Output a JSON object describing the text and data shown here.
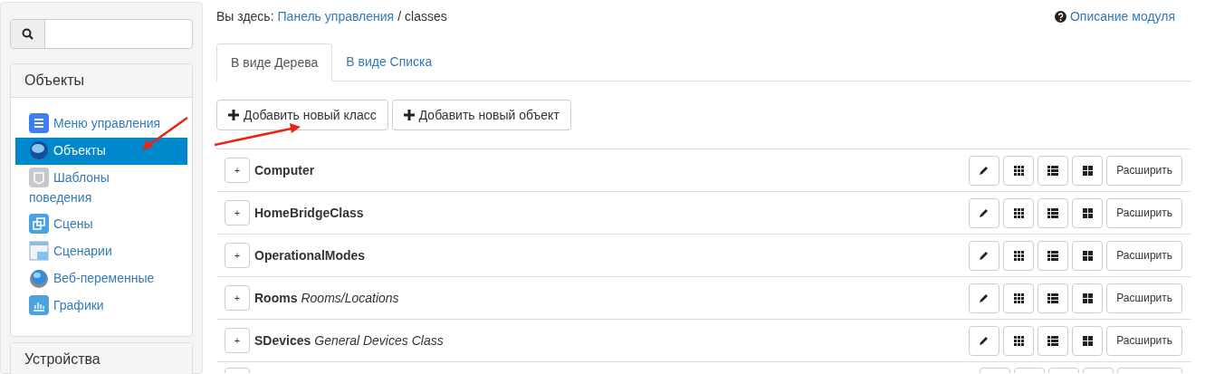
{
  "sidebar": {
    "panels": [
      {
        "title": "Объекты",
        "expanded": true,
        "items": [
          {
            "label": "Меню управления",
            "kind": "menu",
            "selected": false
          },
          {
            "label": "Объекты",
            "kind": "globe",
            "selected": true
          },
          {
            "label": "Шаблоны поведения",
            "kind": "template",
            "selected": false
          },
          {
            "label": "Сцены",
            "kind": "scenes",
            "selected": false
          },
          {
            "label": "Сценарии",
            "kind": "scripts",
            "selected": false
          },
          {
            "label": "Веб-переменные",
            "kind": "webvars",
            "selected": false
          },
          {
            "label": "Графики",
            "kind": "charts",
            "selected": false
          }
        ]
      },
      {
        "title": "Устройства",
        "expanded": false
      }
    ]
  },
  "breadcrumb": {
    "prefix": "Вы здесь:",
    "link": "Панель управления",
    "separator": "/",
    "current": "classes"
  },
  "help_link": "Описание модуля",
  "tabs": [
    {
      "label": "В виде Дерева",
      "selected": true
    },
    {
      "label": "В виде Списка",
      "selected": false
    }
  ],
  "toolbar": [
    "Добавить новый класс",
    "Добавить новый объект"
  ],
  "rows": [
    {
      "kind": "class",
      "toggle": "+",
      "name": "Computer",
      "action": "Расширить"
    },
    {
      "kind": "class",
      "toggle": "+",
      "name": "HomeBridgeClass",
      "action": "Расширить"
    },
    {
      "kind": "class",
      "toggle": "+",
      "name": "OperationalModes",
      "action": "Расширить"
    },
    {
      "kind": "class",
      "toggle": "+",
      "name": "Rooms",
      "description": "Rooms/Locations",
      "action": "Расширить"
    },
    {
      "kind": "class",
      "toggle": "+",
      "name": "SDevices",
      "description": "General Devices Class",
      "action": "Расширить"
    },
    {
      "kind": "cut"
    }
  ]
}
